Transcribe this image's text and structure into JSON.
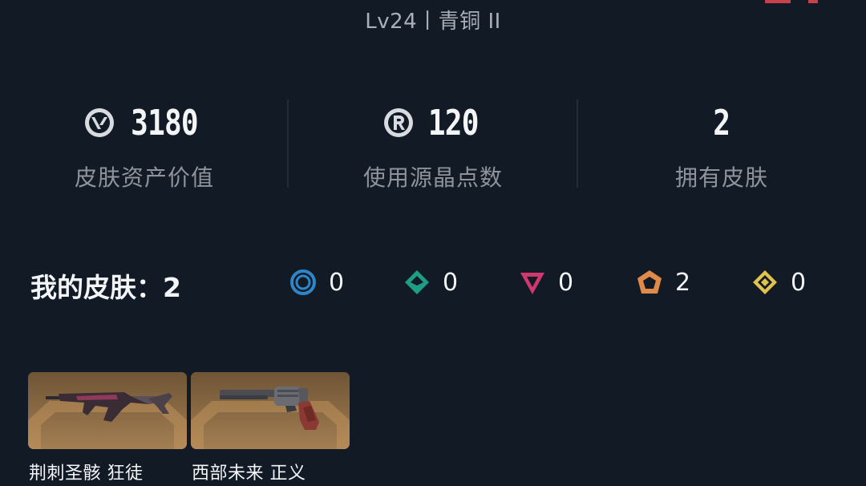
{
  "header": {
    "level_text": "Lv24丨青铜 II"
  },
  "stats": [
    {
      "icon": "valorant-points-icon",
      "value": "3180",
      "label": "皮肤资产价值"
    },
    {
      "icon": "radianite-points-icon",
      "value": "120",
      "label": "使用源晶点数"
    },
    {
      "icon": "",
      "value": "2",
      "label": "拥有皮肤"
    }
  ],
  "my_skins": {
    "title": "我的皮肤：",
    "count": "2",
    "tiers": [
      {
        "icon": "select-tier-icon",
        "color": "#2e86c8",
        "count": "0"
      },
      {
        "icon": "deluxe-tier-icon",
        "color": "#1f9e86",
        "count": "0"
      },
      {
        "icon": "premium-tier-icon",
        "color": "#d0386e",
        "count": "0"
      },
      {
        "icon": "exclusive-tier-icon",
        "color": "#e08a4a",
        "count": "2"
      },
      {
        "icon": "ultra-tier-icon",
        "color": "#e0c24e",
        "count": "0"
      }
    ]
  },
  "skins": [
    {
      "name": "荆刺圣骸 狂徒",
      "icon": "rifle-icon"
    },
    {
      "name": "西部未来 正义",
      "icon": "revolver-icon"
    }
  ],
  "colors": {
    "background": "#121a26",
    "card": "#8a6a44",
    "accent": "#c8414a"
  }
}
